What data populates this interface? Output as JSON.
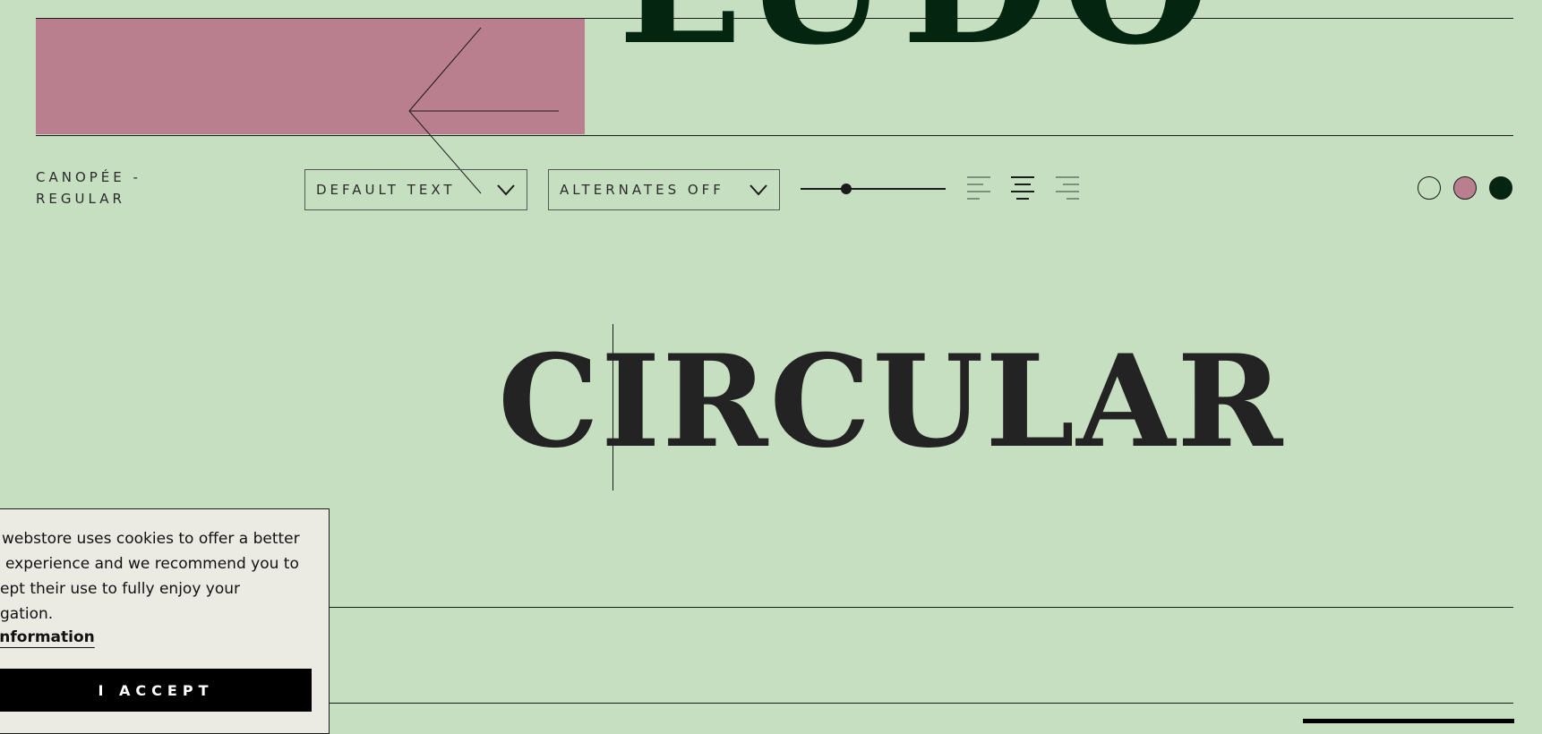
{
  "banner": {
    "display_word": "LUDO",
    "pink_color": "#b97f8f",
    "display_color": "#04250f"
  },
  "controls": {
    "font_name": "CANOPÉE - REGULAR",
    "text_dropdown": {
      "selected": "DEFAULT TEXT",
      "icon": "chevron-down-icon"
    },
    "alternates_dropdown": {
      "selected": "ALTERNATES OFF",
      "icon": "chevron-down-icon"
    },
    "size_slider": {
      "level": 0.3
    },
    "alignment": {
      "options": [
        "left",
        "center",
        "right"
      ],
      "selected": "center"
    },
    "color_swatches": [
      {
        "name": "light",
        "color": "#c6dfc0"
      },
      {
        "name": "pink",
        "color": "#b97f8f"
      },
      {
        "name": "dark",
        "color": "#04250f"
      }
    ]
  },
  "specimen": {
    "text": "CIRCULAR",
    "color": "#232323"
  },
  "background_color": "#c6dfc0",
  "cookie": {
    "message": "webstore uses cookies to offer a better experience and we recommend you to ept their use to fully enjoy your gation.",
    "more_info_link": "e information",
    "accept_label": "I ACCEPT"
  }
}
